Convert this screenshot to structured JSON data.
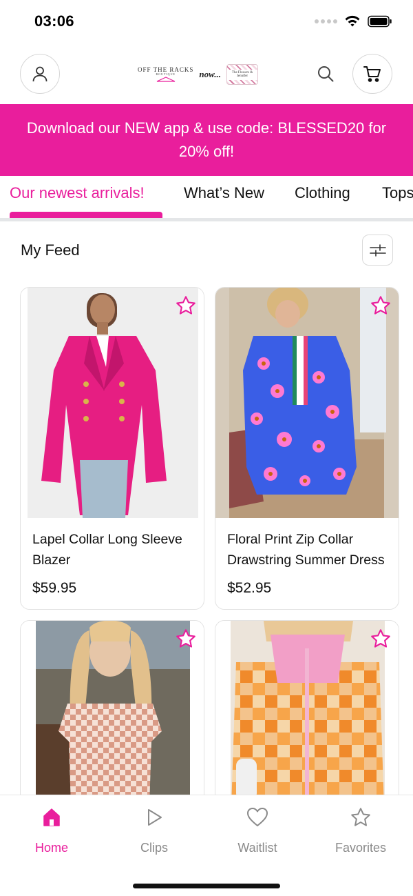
{
  "status_bar": {
    "time": "03:06"
  },
  "header": {
    "logo_main": "OFF THE RACKS",
    "logo_tagline": "BOUTIQUE",
    "logo_now": "now...",
    "logo_badge": "The Flowers & Jennifer"
  },
  "promo": {
    "text": "Download our NEW app & use code: BLESSED20 for 20% off!"
  },
  "tabs": [
    {
      "label": "Our newest arrivals!",
      "active": true
    },
    {
      "label": "What’s New",
      "active": false
    },
    {
      "label": "Clothing",
      "active": false
    },
    {
      "label": "Tops",
      "active": false
    }
  ],
  "feed": {
    "title": "My Feed"
  },
  "products": [
    {
      "title": "Lapel Collar Long Sleeve Blazer",
      "price": "$59.95"
    },
    {
      "title": "Floral Print Zip Collar Drawstring Summer Dress",
      "price": "$52.95"
    },
    {
      "title": "",
      "price": ""
    },
    {
      "title": "",
      "price": ""
    }
  ],
  "bottom_nav": [
    {
      "label": "Home",
      "icon": "home-icon",
      "active": true
    },
    {
      "label": "Clips",
      "icon": "play-icon",
      "active": false
    },
    {
      "label": "Waitlist",
      "icon": "heart-icon",
      "active": false
    },
    {
      "label": "Favorites",
      "icon": "star-icon",
      "active": false
    }
  ],
  "colors": {
    "accent": "#e91e9c",
    "nav_inactive": "#8a8a8a"
  }
}
